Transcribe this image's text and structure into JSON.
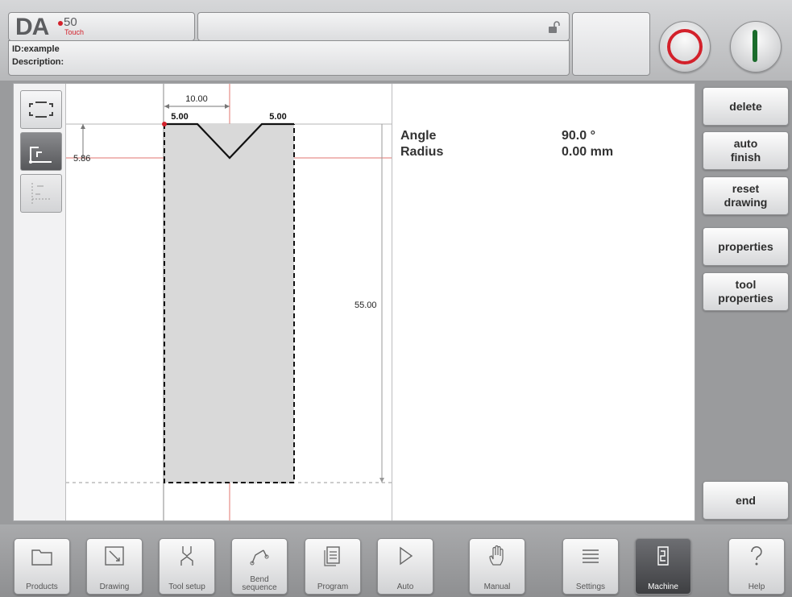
{
  "header": {
    "logo_text": "DA",
    "logo_model": "50",
    "logo_sub": "Touch",
    "id_line": "ID:example",
    "description_line": "Description:"
  },
  "drawing": {
    "dim_width": "10.00",
    "dim_left_flange": "5.00",
    "dim_right_flange": "5.00",
    "dim_depth": "5.86",
    "dim_height": "55.00"
  },
  "properties": {
    "angle_label": "Angle",
    "angle_value": "90.0 °",
    "radius_label": "Radius",
    "radius_value": "0.00 mm"
  },
  "side_buttons": {
    "delete": "delete",
    "auto_finish": "auto\nfinish",
    "reset_drawing": "reset\ndrawing",
    "properties": "properties",
    "tool_properties": "tool\nproperties",
    "end": "end"
  },
  "nav": {
    "products": "Products",
    "drawing": "Drawing",
    "tool_setup": "Tool setup",
    "bend_sequence": "Bend sequence",
    "program": "Program",
    "auto": "Auto",
    "manual": "Manual",
    "settings": "Settings",
    "machine": "Machine",
    "help": "Help"
  },
  "colors": {
    "accent_red": "#d3212b",
    "start_green": "#1a6b2b",
    "active_nav": "#3e3f42"
  }
}
